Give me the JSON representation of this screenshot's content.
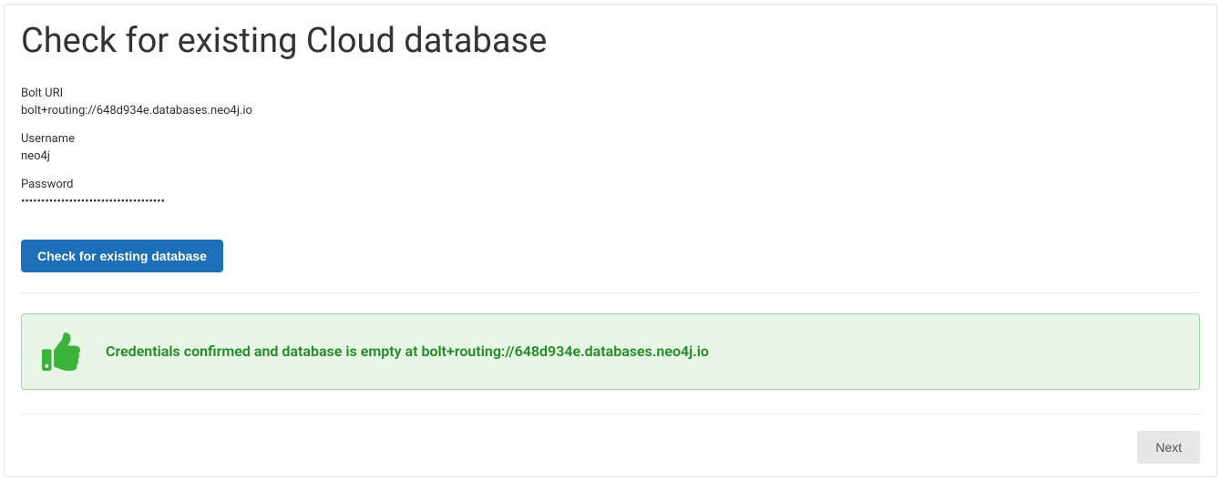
{
  "title": "Check for existing Cloud database",
  "fields": {
    "bolt_uri_label": "Bolt URI",
    "bolt_uri_value": "bolt+routing://648d934e.databases.neo4j.io",
    "username_label": "Username",
    "username_value": "neo4j",
    "password_label": "Password",
    "password_value": "••••••••••••••••••••••••••••••••••••"
  },
  "actions": {
    "check_label": "Check for existing database",
    "next_label": "Next"
  },
  "status": {
    "message": "Credentials confirmed and database is empty at bolt+routing://648d934e.databases.neo4j.io",
    "color_bg": "#e6f5e6",
    "color_border": "#9fd59f",
    "color_text": "#228b22",
    "icon": "thumbs-up-icon"
  }
}
